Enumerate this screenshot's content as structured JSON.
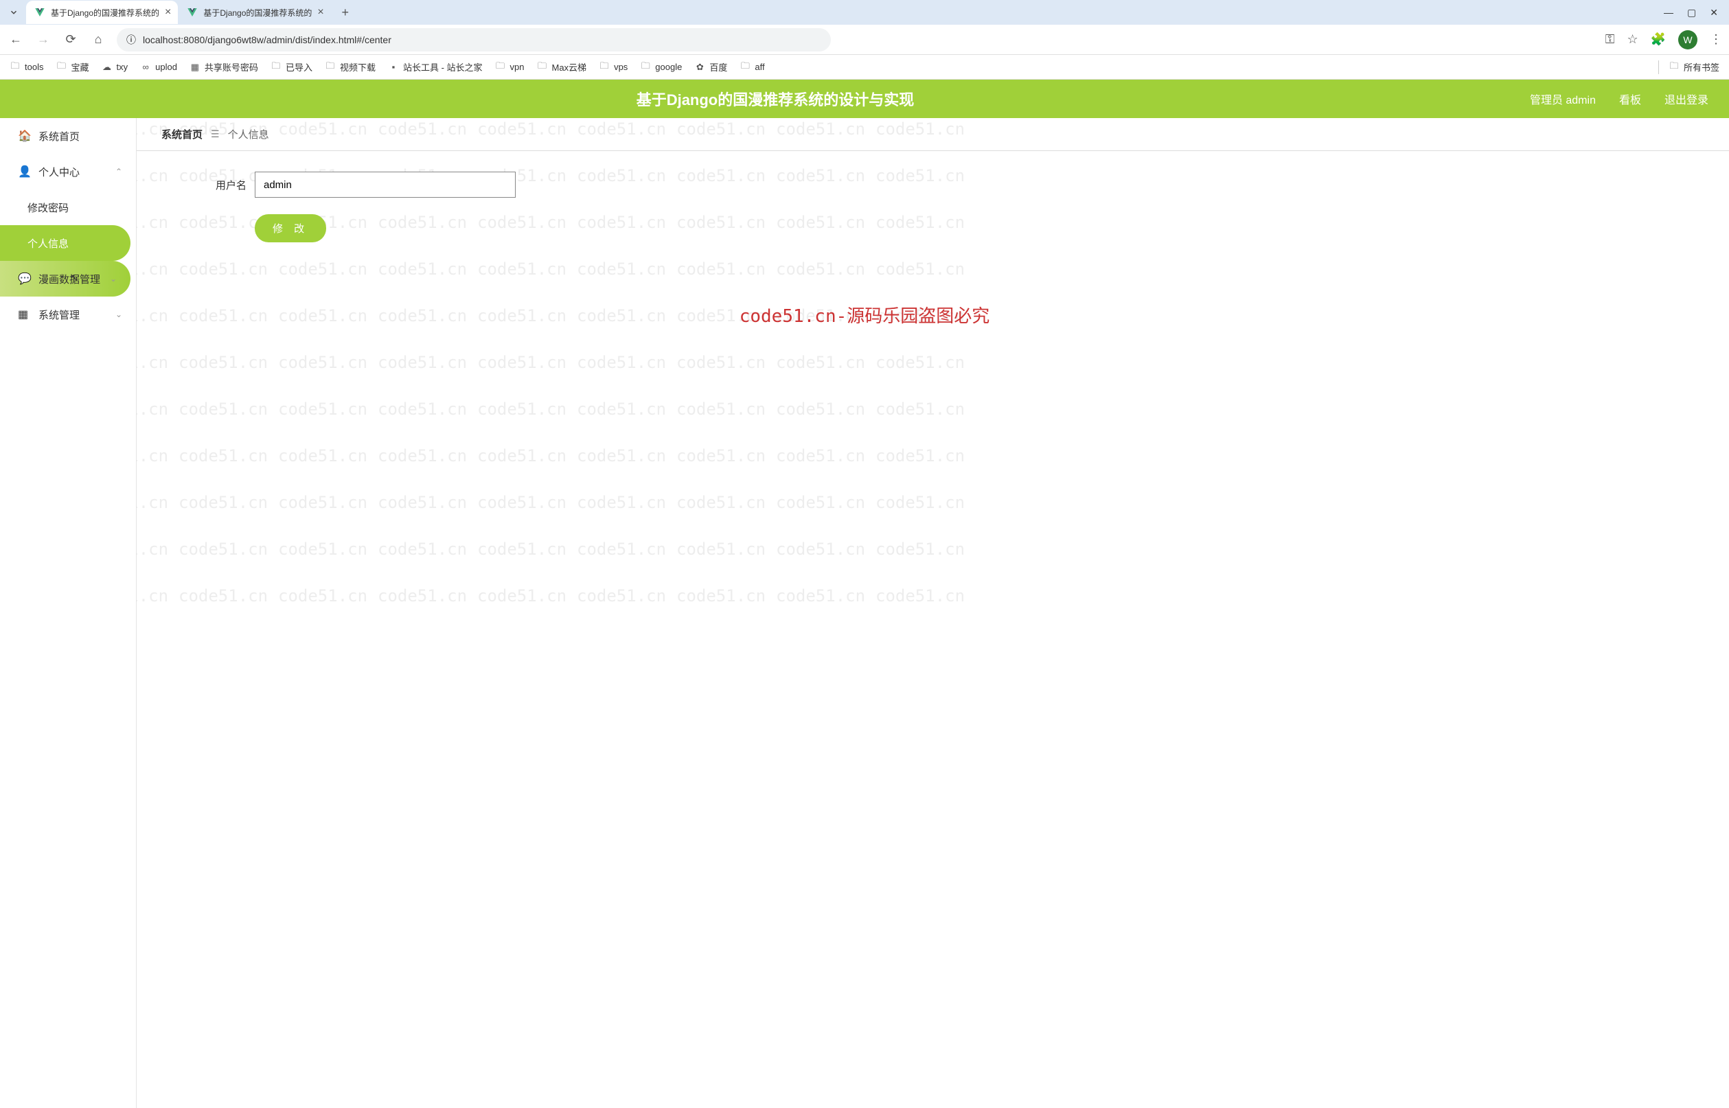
{
  "browser": {
    "tabs": [
      {
        "title": "基于Django的国漫推荐系统的",
        "active": true
      },
      {
        "title": "基于Django的国漫推荐系统的",
        "active": false
      }
    ],
    "url": "localhost:8080/django6wt8w/admin/dist/index.html#/center",
    "avatar_letter": "W",
    "bookmarks": [
      {
        "label": "tools",
        "icon": "folder"
      },
      {
        "label": "宝藏",
        "icon": "folder"
      },
      {
        "label": "txy",
        "icon": "cloud"
      },
      {
        "label": "uplod",
        "icon": "uplod"
      },
      {
        "label": "共享账号密码",
        "icon": "sheet"
      },
      {
        "label": "已导入",
        "icon": "folder"
      },
      {
        "label": "视频下载",
        "icon": "folder"
      },
      {
        "label": "站长工具 - 站长之家",
        "icon": "site"
      },
      {
        "label": "vpn",
        "icon": "folder"
      },
      {
        "label": "Max云梯",
        "icon": "folder"
      },
      {
        "label": "vps",
        "icon": "folder"
      },
      {
        "label": "google",
        "icon": "folder"
      },
      {
        "label": "百度",
        "icon": "baidu"
      },
      {
        "label": "aff",
        "icon": "folder"
      }
    ],
    "all_bookmarks": "所有书签"
  },
  "header": {
    "title": "基于Django的国漫推荐系统的设计与实现",
    "admin_label": "管理员 admin",
    "dashboard": "看板",
    "logout": "退出登录"
  },
  "sidebar": {
    "home": "系统首页",
    "personal_center": "个人中心",
    "change_password": "修改密码",
    "personal_info": "个人信息",
    "comic_data": "漫画数据管理",
    "system_mgmt": "系统管理"
  },
  "breadcrumb": {
    "home": "系统首页",
    "current": "个人信息"
  },
  "form": {
    "username_label": "用户名",
    "username_value": "admin",
    "submit_label": "修 改"
  },
  "watermark": {
    "repeat": "code51.cn",
    "center": "code51.cn-源码乐园盗图必究"
  }
}
